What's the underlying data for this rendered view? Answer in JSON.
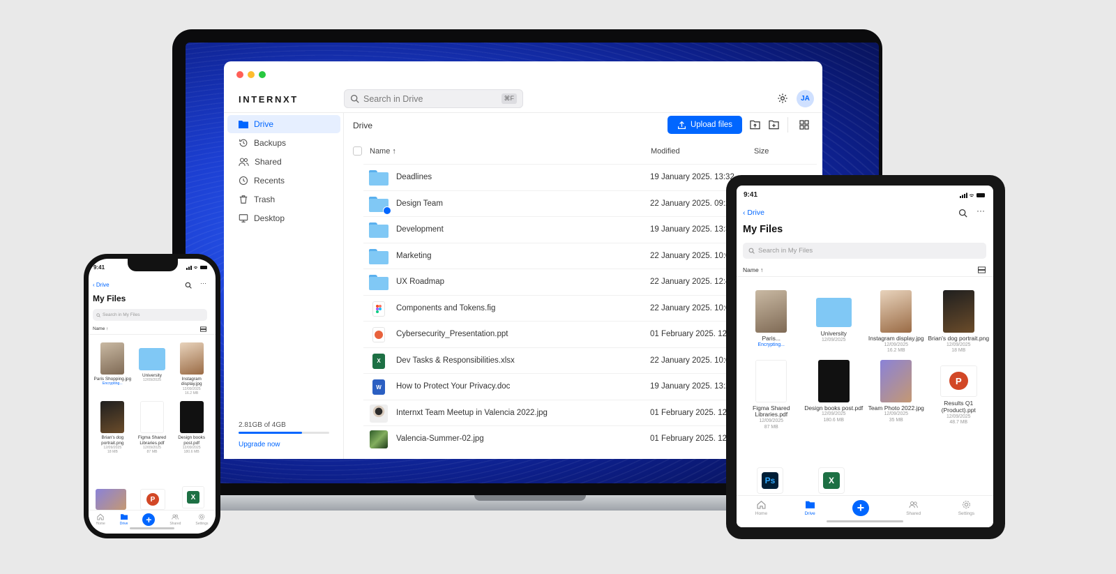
{
  "colors": {
    "accent": "#0066ff",
    "folder": "#80c8f5",
    "window_dots": [
      "#ff5f57",
      "#febc2e",
      "#28c840"
    ]
  },
  "desktop": {
    "brand": "INTERNXT",
    "search": {
      "placeholder": "Search in Drive",
      "shortcut": "⌘F"
    },
    "avatar_initials": "JA",
    "sidebar": [
      {
        "label": "Drive",
        "icon": "folder-icon",
        "active": true
      },
      {
        "label": "Backups",
        "icon": "history-icon"
      },
      {
        "label": "Shared",
        "icon": "users-icon"
      },
      {
        "label": "Recents",
        "icon": "clock-icon"
      },
      {
        "label": "Trash",
        "icon": "trash-icon"
      },
      {
        "label": "Desktop",
        "icon": "monitor-icon"
      }
    ],
    "storage": {
      "used_label": "2.81GB of 4GB",
      "fraction_used": 0.7,
      "upgrade_label": "Upgrade now"
    },
    "breadcrumb": "Drive",
    "upload_label": "Upload files",
    "columns": {
      "name": "Name",
      "sort_arrow": "↑",
      "modified": "Modified",
      "size": "Size"
    },
    "files": [
      {
        "name": "Deadlines",
        "modified": "19 January 2025. 13:32",
        "kind": "folder"
      },
      {
        "name": "Design Team",
        "modified": "22 January 2025. 09:29",
        "kind": "shared-folder"
      },
      {
        "name": "Development",
        "modified": "19 January 2025. 13:34",
        "kind": "folder"
      },
      {
        "name": "Marketing",
        "modified": "22 January 2025. 10:08",
        "kind": "folder"
      },
      {
        "name": "UX Roadmap",
        "modified": "22 January 2025. 12:44",
        "kind": "folder"
      },
      {
        "name": "Components and Tokens.fig",
        "modified": "22 January 2025. 10:08",
        "kind": "figma"
      },
      {
        "name": "Cybersecurity_Presentation.ppt",
        "modified": "01 February 2025. 12:31",
        "kind": "ppt"
      },
      {
        "name": "Dev Tasks & Responsibilities.xlsx",
        "modified": "22 January 2025. 10:08",
        "kind": "xlsx"
      },
      {
        "name": "How to Protect Your Privacy.doc",
        "modified": "19 January 2025. 13:25",
        "kind": "doc"
      },
      {
        "name": "Internxt Team Meetup in Valencia 2022.jpg",
        "modified": "01 February 2025. 12:31",
        "kind": "photo-person"
      },
      {
        "name": "Valencia-Summer-02.jpg",
        "modified": "01 February 2025. 12:31",
        "kind": "photo-nature"
      }
    ]
  },
  "phone": {
    "time": "9:41",
    "back_label": "Drive",
    "title": "My Files",
    "search_placeholder": "Search in My Files",
    "sort_label": "Name ↑",
    "items": [
      {
        "name": "Paris Shopping.jpg",
        "sub": "Encrypting...",
        "thumb": "pimg-a",
        "encrypting": true
      },
      {
        "name": "University",
        "sub": "12/09/2025",
        "thumb": "folder"
      },
      {
        "name": "Instagram display.jpg",
        "sub": "12/09/2025",
        "size": "16.2 MB",
        "thumb": "pimg-b"
      },
      {
        "name": "Brian's dog portrait.png",
        "sub": "12/09/2025",
        "size": "18 MB",
        "thumb": "pimg-c"
      },
      {
        "name": "Figma Shared Libraries.pdf",
        "sub": "12/09/2025",
        "size": "87 MB",
        "thumb": "pimg-d"
      },
      {
        "name": "Design books post.pdf",
        "sub": "12/09/2025",
        "size": "180.6 MB",
        "thumb": "pimg-e"
      }
    ],
    "tabs": [
      {
        "label": "Home"
      },
      {
        "label": "Drive",
        "active": true
      },
      {
        "label": "+"
      },
      {
        "label": "Shared"
      },
      {
        "label": "Settings"
      }
    ]
  },
  "tablet": {
    "time": "9:41",
    "back_label": "Drive",
    "title": "My Files",
    "search_placeholder": "Search in My Files",
    "sort_label": "Name ↑",
    "items": [
      {
        "name": "Paris...",
        "sub": "Encrypting...",
        "thumb": "pimg-a",
        "encrypting": true
      },
      {
        "name": "University",
        "sub": "12/09/2025",
        "thumb": "folder"
      },
      {
        "name": "Instagram display.jpg",
        "sub": "12/09/2025",
        "size": "16.2 MB",
        "thumb": "pimg-b"
      },
      {
        "name": "Brian's dog portrait.png",
        "sub": "12/09/2025",
        "size": "18 MB",
        "thumb": "pimg-c"
      },
      {
        "name": "Figma Shared Libraries.pdf",
        "sub": "12/09/2025",
        "size": "87 MB",
        "thumb": "pimg-d"
      },
      {
        "name": "Design books post.pdf",
        "sub": "12/09/2025",
        "size": "180.6 MB",
        "thumb": "pimg-e"
      },
      {
        "name": "Team Photo 2022.jpg",
        "sub": "12/09/2025",
        "size": "35 MB",
        "thumb": "pimg-f"
      },
      {
        "name": "Results Q1 (Product).ppt",
        "sub": "12/09/2025",
        "size": "48.7 MB",
        "thumb": "pimg-g"
      }
    ],
    "tabs": [
      {
        "label": "Home"
      },
      {
        "label": "Drive",
        "active": true
      },
      {
        "label": "+"
      },
      {
        "label": "Shared"
      },
      {
        "label": "Settings"
      }
    ]
  }
}
